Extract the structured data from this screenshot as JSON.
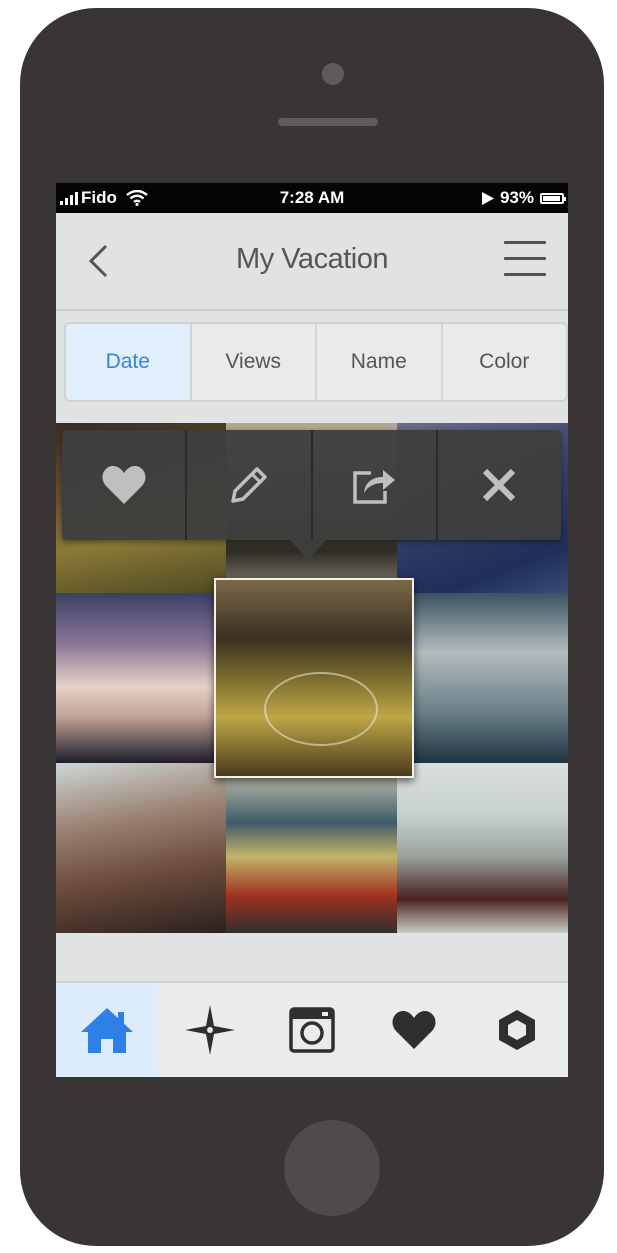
{
  "status_bar": {
    "carrier": "Fido",
    "time": "7:28 AM",
    "battery": "93%"
  },
  "nav": {
    "title": "My Vacation",
    "back_icon": "chevron-left-icon",
    "menu_icon": "hamburger-menu-icon"
  },
  "sort_tabs": [
    {
      "label": "Date",
      "active": true
    },
    {
      "label": "Views",
      "active": false
    },
    {
      "label": "Name",
      "active": false
    },
    {
      "label": "Color",
      "active": false
    }
  ],
  "popover_actions": [
    {
      "name": "favorite",
      "icon": "heart-icon"
    },
    {
      "name": "edit",
      "icon": "pencil-icon"
    },
    {
      "name": "share",
      "icon": "share-icon"
    },
    {
      "name": "close",
      "icon": "close-icon"
    }
  ],
  "bottom_tabs": [
    {
      "name": "home",
      "icon": "home-icon",
      "active": true
    },
    {
      "name": "explore",
      "icon": "compass-star-icon",
      "active": false
    },
    {
      "name": "camera",
      "icon": "camera-icon",
      "active": false
    },
    {
      "name": "favorites",
      "icon": "heart-icon",
      "active": false
    },
    {
      "name": "settings",
      "icon": "hexagon-icon",
      "active": false
    }
  ],
  "colors": {
    "accent": "#3585d8",
    "active_bg": "#dcecfc",
    "popover_bg": "#3e3e3e",
    "phone_body": "#3a3535"
  }
}
